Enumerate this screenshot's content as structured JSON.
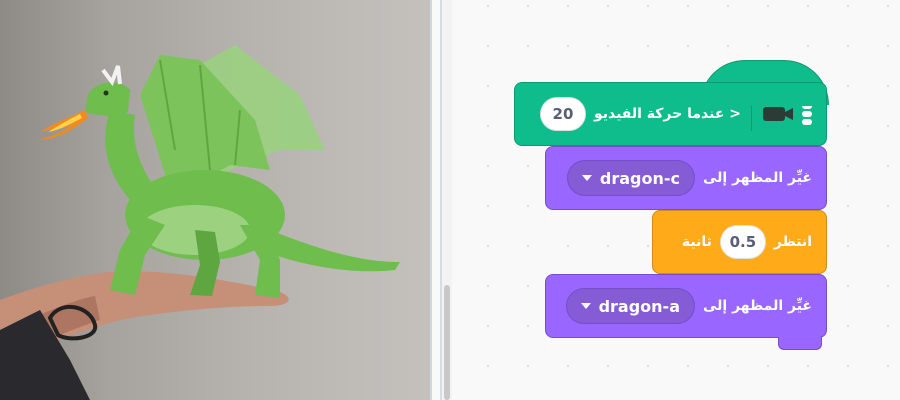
{
  "stage": {
    "description_icon": "dragon-sprite"
  },
  "blocks": {
    "hat": {
      "label": "عندما حركة الفيديو >",
      "value": "20",
      "icon": "video-camera-icon"
    },
    "switch_costume_1": {
      "label": "غيِّر المظهر إلى",
      "value": "dragon-c"
    },
    "wait": {
      "label_before": "انتظر",
      "value": "0.5",
      "label_after": "ثانية"
    },
    "switch_costume_2": {
      "label": "غيِّر المظهر إلى",
      "value": "dragon-a"
    }
  },
  "colors": {
    "video_sensing": "#0fbd8c",
    "looks": "#9966ff",
    "control": "#ffab19"
  }
}
